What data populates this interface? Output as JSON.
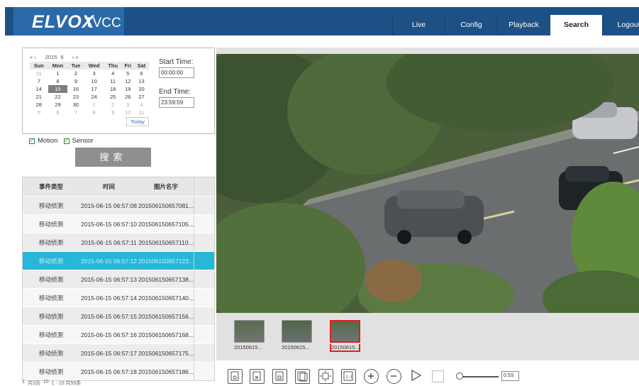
{
  "header": {
    "brand": "ELVOX",
    "product": "TVCC",
    "nav": [
      "Live",
      "Config",
      "Playback",
      "Search",
      "Logout"
    ],
    "active_nav": "Search"
  },
  "calendar": {
    "prev_label": "« ‹",
    "year": "2015",
    "month": "6",
    "next_label": "› »",
    "weekdays": [
      "Sun",
      "Mon",
      "Tue",
      "Wed",
      "Thu",
      "Fri",
      "Sat"
    ],
    "weeks": [
      [
        "31",
        "1",
        "2",
        "3",
        "4",
        "5",
        "6"
      ],
      [
        "7",
        "8",
        "9",
        "10",
        "11",
        "12",
        "13"
      ],
      [
        "14",
        "15",
        "16",
        "17",
        "18",
        "19",
        "20"
      ],
      [
        "21",
        "22",
        "23",
        "24",
        "25",
        "26",
        "27"
      ],
      [
        "28",
        "29",
        "30",
        "1",
        "2",
        "3",
        "4"
      ],
      [
        "5",
        "6",
        "7",
        "8",
        "9",
        "10",
        "11"
      ]
    ],
    "selected": "15",
    "today_label": "Today"
  },
  "time": {
    "start_label": "Start Time:",
    "start_value": "00:00:00",
    "end_label": "End Time:",
    "end_value": "23:59:59"
  },
  "filters": {
    "motion": "Motion",
    "sensor": "Sensor"
  },
  "search_button": "搜索",
  "table": {
    "headers": [
      "事件类型",
      "时间",
      "图片名字"
    ],
    "rows": [
      [
        "移动侦测",
        "2015-06-15 06:57:08",
        "201506150657081..."
      ],
      [
        "移动侦测",
        "2015-06-15 06:57:10",
        "201506150657105..."
      ],
      [
        "移动侦测",
        "2015-06-15 06:57:11",
        "201506150657110..."
      ],
      [
        "移动侦测",
        "2015-06-15 06:57:12",
        "201506150657123..."
      ],
      [
        "移动侦测",
        "2015-06-15 06:57:13",
        "201506150657138..."
      ],
      [
        "移动侦测",
        "2015-06-15 06:57:14",
        "201506150657140..."
      ],
      [
        "移动侦测",
        "2015-06-15 06:57:15",
        "201506150657156..."
      ],
      [
        "移动侦测",
        "2015-06-15 06:57:16",
        "201506150657168..."
      ],
      [
        "移动侦测",
        "2015-06-15 06:57:17",
        "201506150657175..."
      ],
      [
        "移动侦测",
        "2015-06-15 06:57:18",
        "201506150657186..."
      ]
    ],
    "selected_row": 3
  },
  "pager": [
    "1",
    "共3页",
    "10",
    "1 - 10  共55条"
  ],
  "thumbnails": [
    "20150615...",
    "20150615...",
    "20150615..."
  ],
  "selected_thumbnail": 2,
  "toolbar": {
    "speed": "0.5S",
    "icons": [
      "snapshot-icon",
      "delete-icon",
      "save-icon",
      "save-all-icon",
      "fit-icon",
      "original-size-icon",
      "zoom-in-icon",
      "zoom-out-icon",
      "play-icon",
      "stop-icon"
    ]
  }
}
